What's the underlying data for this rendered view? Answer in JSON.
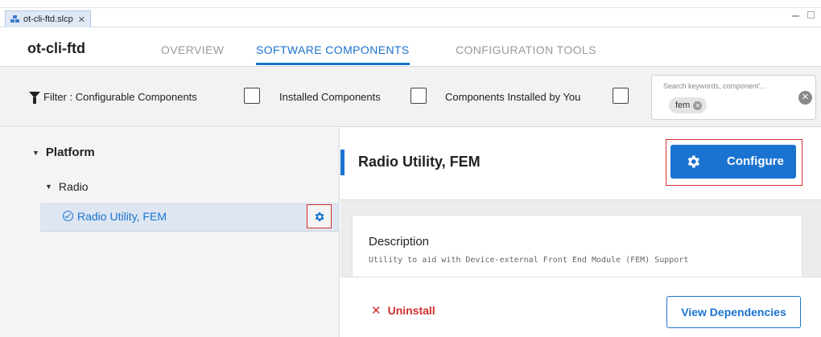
{
  "editor": {
    "tab_label": "ot-cli-ftd.slcp",
    "tab_close": "✕"
  },
  "header": {
    "project_name": "ot-cli-ftd",
    "tabs": [
      {
        "label": "OVERVIEW",
        "active": false
      },
      {
        "label": "SOFTWARE COMPONENTS",
        "active": true
      },
      {
        "label": "CONFIGURATION TOOLS",
        "active": false
      }
    ]
  },
  "filter": {
    "label": "Filter :",
    "options": [
      {
        "label": "Configurable Components",
        "checked": false
      },
      {
        "label": "Installed Components",
        "checked": false
      },
      {
        "label": "Components Installed by You",
        "checked": false
      }
    ],
    "search": {
      "placeholder": "Search keywords, component'...",
      "chips": [
        "fem"
      ]
    }
  },
  "tree": {
    "platform": "Platform",
    "radio": "Radio",
    "component": "Radio Utility, FEM"
  },
  "detail": {
    "title": "Radio Utility, FEM",
    "configure_label": "Configure",
    "description_title": "Description",
    "description_text": "Utility to aid with Device-external Front End Module (FEM) Support",
    "uninstall_label": "Uninstall",
    "view_dependencies_label": "View Dependencies"
  },
  "colors": {
    "accent": "#1a73d1",
    "highlight_outline": "#d32f2f",
    "danger": "#d32f2f"
  }
}
